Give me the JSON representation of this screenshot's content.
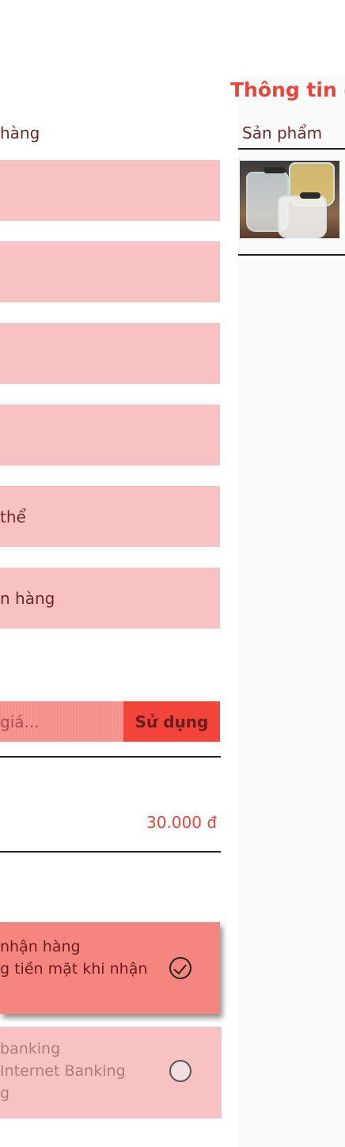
{
  "order_form": {
    "shipping_label_partial": "hàng",
    "fields": [
      {
        "value": ""
      },
      {
        "value": ""
      },
      {
        "value": ""
      },
      {
        "value": ""
      },
      {
        "value": "thể"
      },
      {
        "value": "n hàng"
      }
    ],
    "coupon": {
      "placeholder_partial": "giá...",
      "apply_label": "Sử dụng"
    },
    "shipping_fee": "30.000 đ",
    "payment_methods": [
      {
        "line1": "nhận hàng",
        "line2": "g tiền mặt khi nhận",
        "selected": true
      },
      {
        "line1": " banking",
        "line2": " Internet Banking",
        "line3": "g",
        "selected": false
      }
    ]
  },
  "order_summary": {
    "title_partial": "Thông tin đ",
    "column_product": "Sản phẩm",
    "product_image_icon": "glass-mugs-photo"
  },
  "colors": {
    "accent": "#e8453a",
    "field_bg": "#f8c2c2",
    "selected_bg": "#f4857f",
    "button_bg": "#f2443b"
  }
}
